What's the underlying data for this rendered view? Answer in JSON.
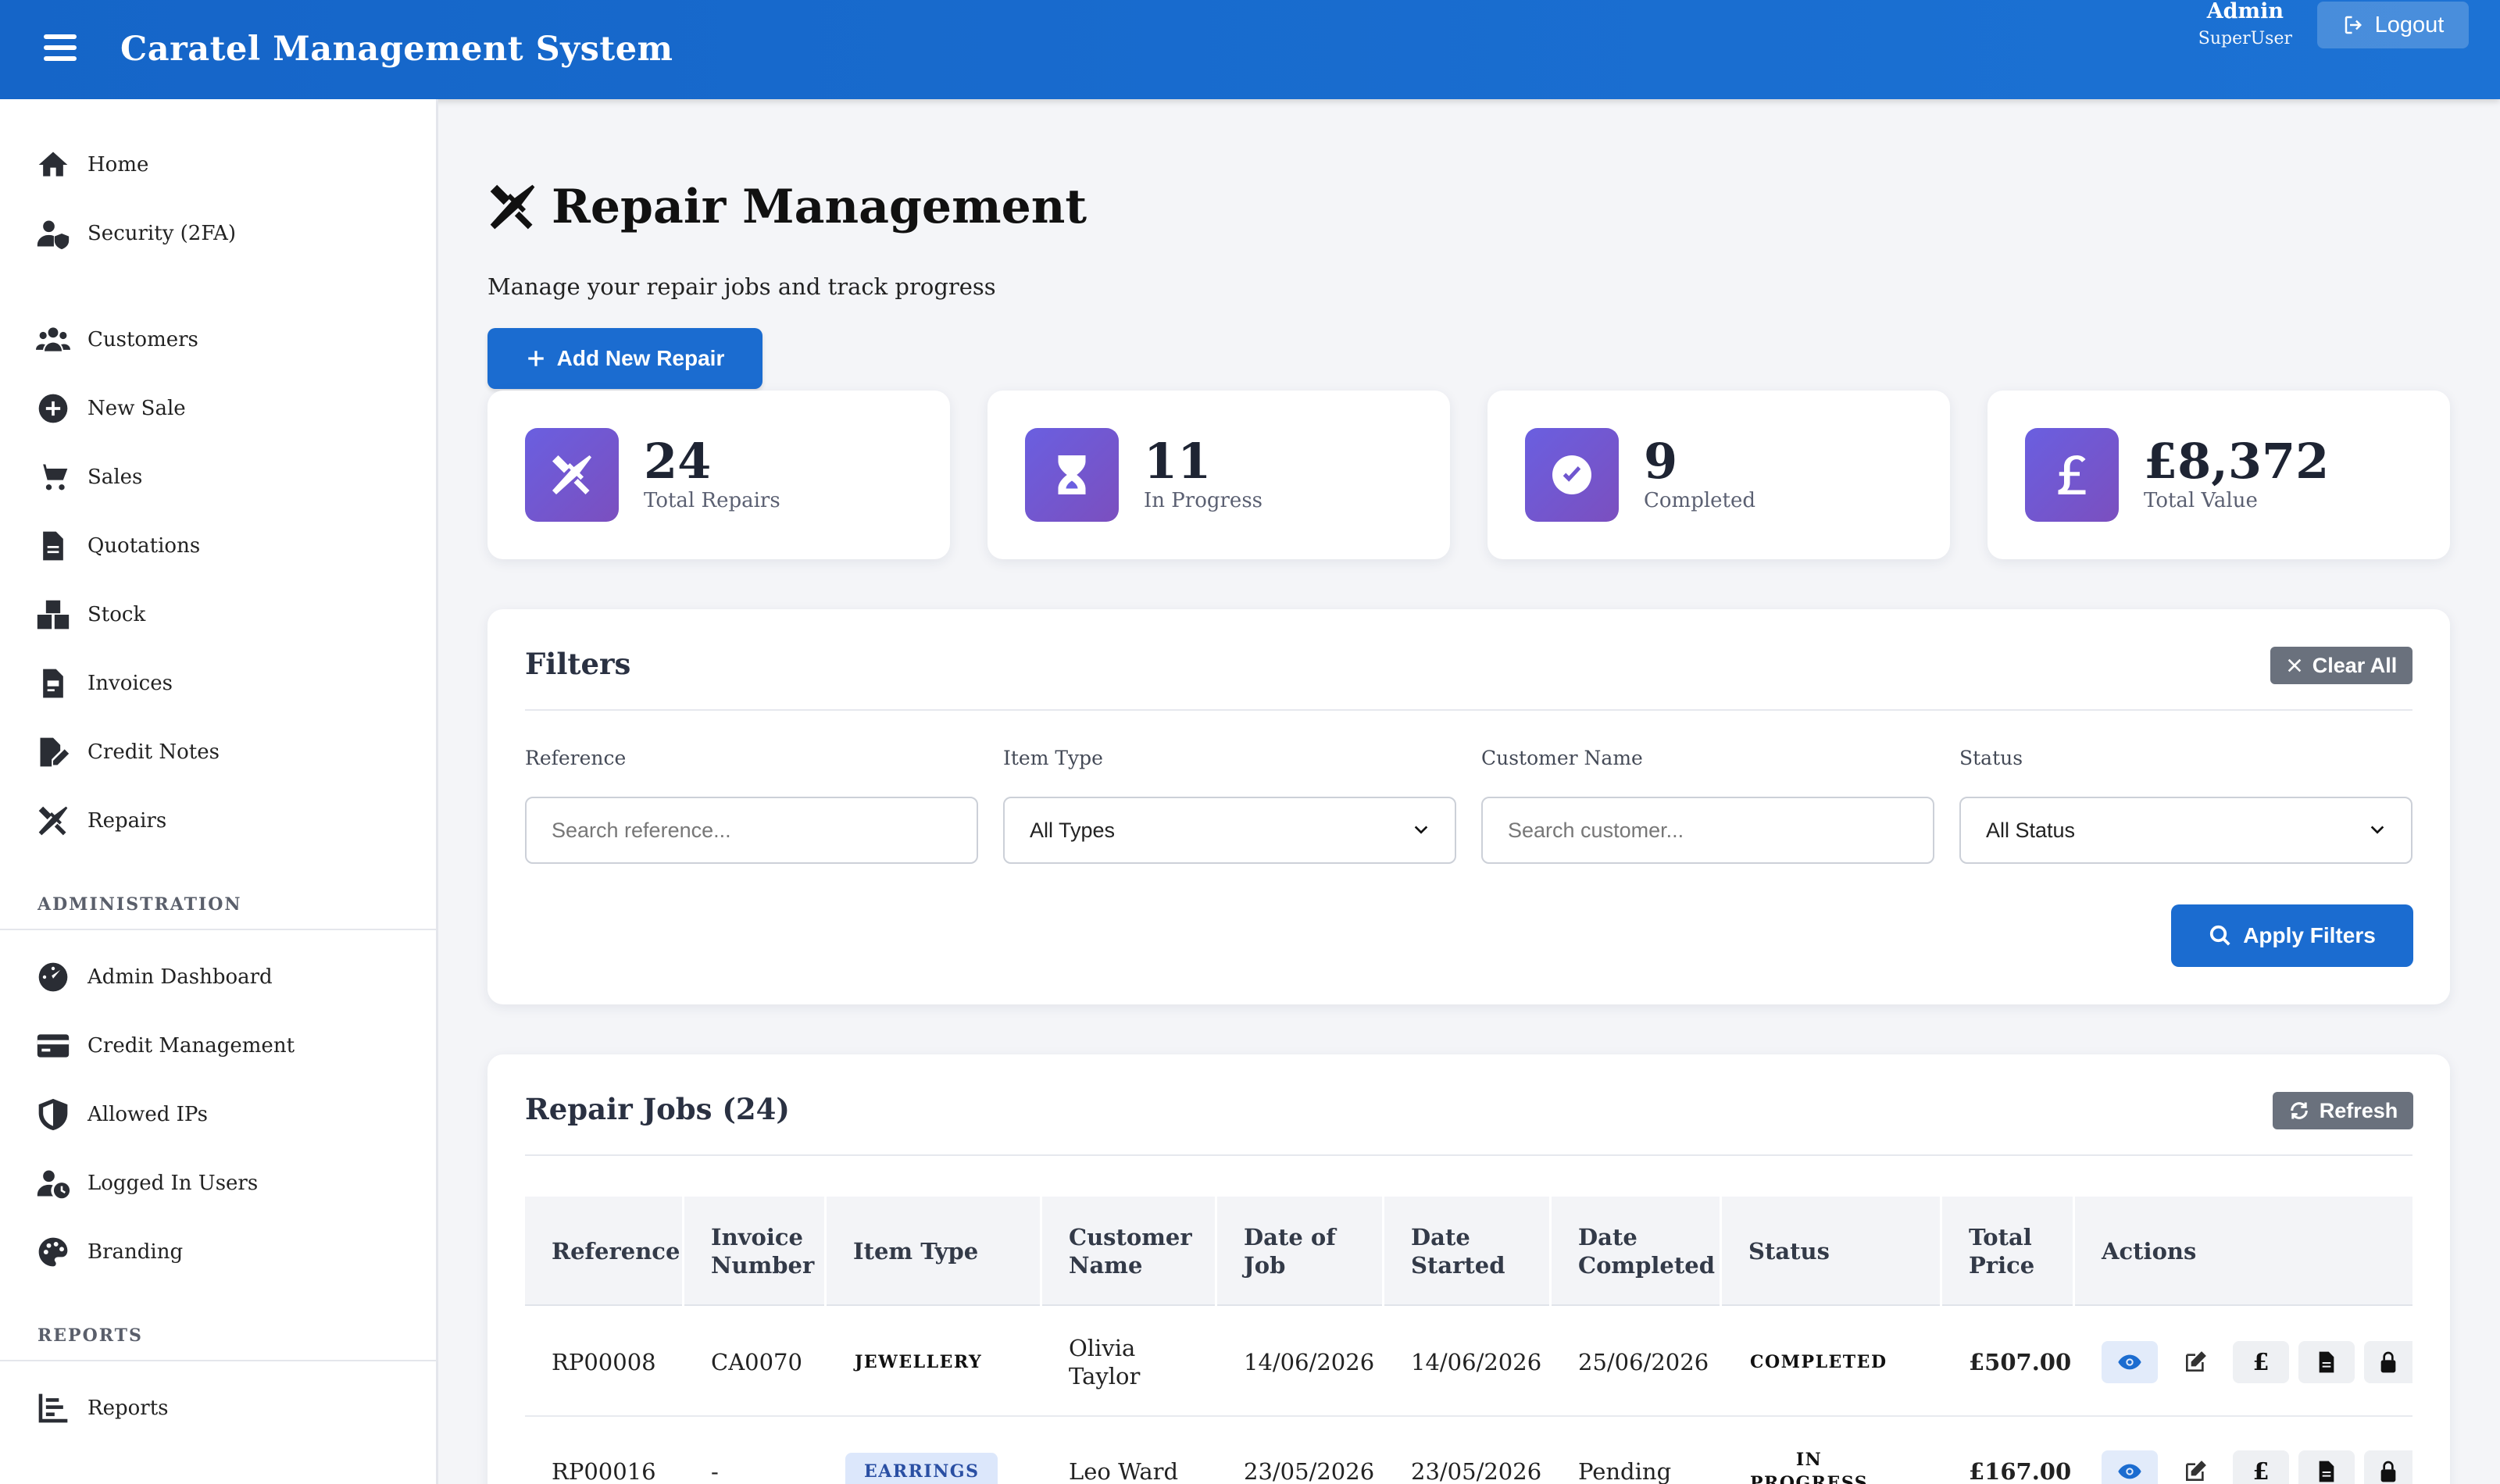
{
  "header": {
    "title": "Caratel Management System",
    "user_name": "Admin",
    "user_role": "SuperUser",
    "logout_label": "Logout"
  },
  "sidebar": {
    "items": [
      {
        "label": "Home",
        "icon": "home-icon"
      },
      {
        "label": "Security (2FA)",
        "icon": "user-shield-icon"
      },
      {
        "label": "Customers",
        "icon": "users-icon"
      },
      {
        "label": "New Sale",
        "icon": "plus-circle-icon"
      },
      {
        "label": "Sales",
        "icon": "cart-icon"
      },
      {
        "label": "Quotations",
        "icon": "file-icon"
      },
      {
        "label": "Stock",
        "icon": "boxes-icon"
      },
      {
        "label": "Invoices",
        "icon": "invoice-icon"
      },
      {
        "label": "Credit Notes",
        "icon": "edit-file-icon"
      },
      {
        "label": "Repairs",
        "icon": "tools-icon"
      }
    ],
    "admin_label": "ADMINISTRATION",
    "admin_items": [
      {
        "label": "Admin Dashboard",
        "icon": "gauge-icon"
      },
      {
        "label": "Credit Management",
        "icon": "credit-card-icon"
      },
      {
        "label": "Allowed IPs",
        "icon": "shield-icon"
      },
      {
        "label": "Logged In Users",
        "icon": "user-clock-icon"
      },
      {
        "label": "Branding",
        "icon": "palette-icon"
      }
    ],
    "reports_label": "REPORTS",
    "report_items": [
      {
        "label": "Reports",
        "icon": "chart-icon"
      }
    ]
  },
  "page": {
    "title": "Repair Management",
    "subtitle": "Manage your repair jobs and track progress",
    "add_label": "Add New Repair"
  },
  "stats": [
    {
      "value": "24",
      "label": "Total Repairs",
      "icon": "tools-icon"
    },
    {
      "value": "11",
      "label": "In Progress",
      "icon": "hourglass-icon"
    },
    {
      "value": "9",
      "label": "Completed",
      "icon": "check-circle-icon"
    },
    {
      "value": "£8,372",
      "label": "Total Value",
      "icon": "pound-icon"
    }
  ],
  "filters": {
    "title": "Filters",
    "clear_label": "Clear All",
    "reference_label": "Reference",
    "reference_placeholder": "Search reference...",
    "item_type_label": "Item Type",
    "item_type_value": "All Types",
    "customer_label": "Customer Name",
    "customer_placeholder": "Search customer...",
    "status_label": "Status",
    "status_value": "All Status",
    "apply_label": "Apply Filters"
  },
  "table": {
    "title": "Repair Jobs (24)",
    "refresh_label": "Refresh",
    "columns": [
      "Reference",
      "Invoice Number",
      "Item Type",
      "Customer Name",
      "Date of Job",
      "Date Started",
      "Date Completed",
      "Status",
      "Total Price",
      "Actions"
    ],
    "rows": [
      {
        "reference": "RP00008",
        "invoice": "CA0070",
        "item_type": "JEWELLERY",
        "customer": "Olivia Taylor",
        "date_job": "14/06/2026",
        "date_started": "14/06/2026",
        "date_completed": "25/06/2026",
        "status": "COMPLETED",
        "price": "£507.00"
      },
      {
        "reference": "RP00016",
        "invoice": "-",
        "item_type": "EARRINGS",
        "customer": "Leo Ward",
        "date_job": "23/05/2026",
        "date_started": "23/05/2026",
        "date_completed": "Pending",
        "status": "IN PROGRESS",
        "price": "£167.00"
      }
    ],
    "pound_symbol": "£"
  },
  "colors": {
    "header": "#1565c8",
    "primary": "#1b6cd0",
    "stat_icon": "#6a5fe0",
    "secondary_button": "#6a717d"
  }
}
